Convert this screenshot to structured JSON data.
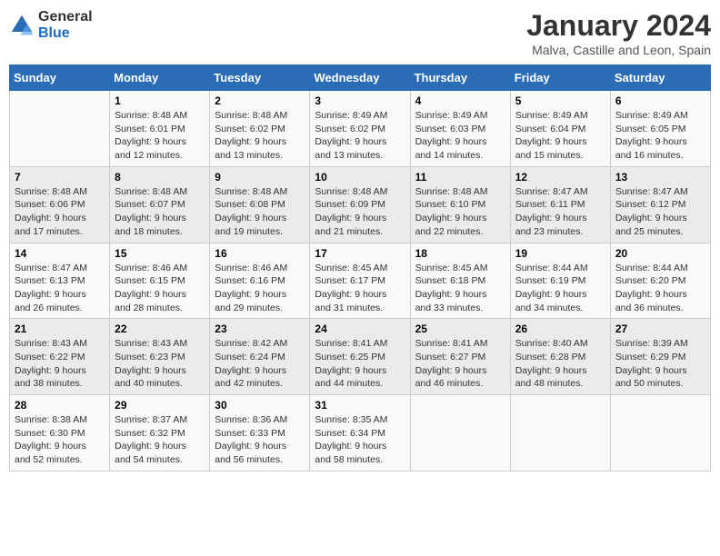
{
  "logo": {
    "general": "General",
    "blue": "Blue"
  },
  "header": {
    "month": "January 2024",
    "location": "Malva, Castille and Leon, Spain"
  },
  "columns": [
    "Sunday",
    "Monday",
    "Tuesday",
    "Wednesday",
    "Thursday",
    "Friday",
    "Saturday"
  ],
  "weeks": [
    [
      {
        "day": "",
        "content": ""
      },
      {
        "day": "1",
        "content": "Sunrise: 8:48 AM\nSunset: 6:01 PM\nDaylight: 9 hours\nand 12 minutes."
      },
      {
        "day": "2",
        "content": "Sunrise: 8:48 AM\nSunset: 6:02 PM\nDaylight: 9 hours\nand 13 minutes."
      },
      {
        "day": "3",
        "content": "Sunrise: 8:49 AM\nSunset: 6:02 PM\nDaylight: 9 hours\nand 13 minutes."
      },
      {
        "day": "4",
        "content": "Sunrise: 8:49 AM\nSunset: 6:03 PM\nDaylight: 9 hours\nand 14 minutes."
      },
      {
        "day": "5",
        "content": "Sunrise: 8:49 AM\nSunset: 6:04 PM\nDaylight: 9 hours\nand 15 minutes."
      },
      {
        "day": "6",
        "content": "Sunrise: 8:49 AM\nSunset: 6:05 PM\nDaylight: 9 hours\nand 16 minutes."
      }
    ],
    [
      {
        "day": "7",
        "content": "Sunrise: 8:48 AM\nSunset: 6:06 PM\nDaylight: 9 hours\nand 17 minutes."
      },
      {
        "day": "8",
        "content": "Sunrise: 8:48 AM\nSunset: 6:07 PM\nDaylight: 9 hours\nand 18 minutes."
      },
      {
        "day": "9",
        "content": "Sunrise: 8:48 AM\nSunset: 6:08 PM\nDaylight: 9 hours\nand 19 minutes."
      },
      {
        "day": "10",
        "content": "Sunrise: 8:48 AM\nSunset: 6:09 PM\nDaylight: 9 hours\nand 21 minutes."
      },
      {
        "day": "11",
        "content": "Sunrise: 8:48 AM\nSunset: 6:10 PM\nDaylight: 9 hours\nand 22 minutes."
      },
      {
        "day": "12",
        "content": "Sunrise: 8:47 AM\nSunset: 6:11 PM\nDaylight: 9 hours\nand 23 minutes."
      },
      {
        "day": "13",
        "content": "Sunrise: 8:47 AM\nSunset: 6:12 PM\nDaylight: 9 hours\nand 25 minutes."
      }
    ],
    [
      {
        "day": "14",
        "content": "Sunrise: 8:47 AM\nSunset: 6:13 PM\nDaylight: 9 hours\nand 26 minutes."
      },
      {
        "day": "15",
        "content": "Sunrise: 8:46 AM\nSunset: 6:15 PM\nDaylight: 9 hours\nand 28 minutes."
      },
      {
        "day": "16",
        "content": "Sunrise: 8:46 AM\nSunset: 6:16 PM\nDaylight: 9 hours\nand 29 minutes."
      },
      {
        "day": "17",
        "content": "Sunrise: 8:45 AM\nSunset: 6:17 PM\nDaylight: 9 hours\nand 31 minutes."
      },
      {
        "day": "18",
        "content": "Sunrise: 8:45 AM\nSunset: 6:18 PM\nDaylight: 9 hours\nand 33 minutes."
      },
      {
        "day": "19",
        "content": "Sunrise: 8:44 AM\nSunset: 6:19 PM\nDaylight: 9 hours\nand 34 minutes."
      },
      {
        "day": "20",
        "content": "Sunrise: 8:44 AM\nSunset: 6:20 PM\nDaylight: 9 hours\nand 36 minutes."
      }
    ],
    [
      {
        "day": "21",
        "content": "Sunrise: 8:43 AM\nSunset: 6:22 PM\nDaylight: 9 hours\nand 38 minutes."
      },
      {
        "day": "22",
        "content": "Sunrise: 8:43 AM\nSunset: 6:23 PM\nDaylight: 9 hours\nand 40 minutes."
      },
      {
        "day": "23",
        "content": "Sunrise: 8:42 AM\nSunset: 6:24 PM\nDaylight: 9 hours\nand 42 minutes."
      },
      {
        "day": "24",
        "content": "Sunrise: 8:41 AM\nSunset: 6:25 PM\nDaylight: 9 hours\nand 44 minutes."
      },
      {
        "day": "25",
        "content": "Sunrise: 8:41 AM\nSunset: 6:27 PM\nDaylight: 9 hours\nand 46 minutes."
      },
      {
        "day": "26",
        "content": "Sunrise: 8:40 AM\nSunset: 6:28 PM\nDaylight: 9 hours\nand 48 minutes."
      },
      {
        "day": "27",
        "content": "Sunrise: 8:39 AM\nSunset: 6:29 PM\nDaylight: 9 hours\nand 50 minutes."
      }
    ],
    [
      {
        "day": "28",
        "content": "Sunrise: 8:38 AM\nSunset: 6:30 PM\nDaylight: 9 hours\nand 52 minutes."
      },
      {
        "day": "29",
        "content": "Sunrise: 8:37 AM\nSunset: 6:32 PM\nDaylight: 9 hours\nand 54 minutes."
      },
      {
        "day": "30",
        "content": "Sunrise: 8:36 AM\nSunset: 6:33 PM\nDaylight: 9 hours\nand 56 minutes."
      },
      {
        "day": "31",
        "content": "Sunrise: 8:35 AM\nSunset: 6:34 PM\nDaylight: 9 hours\nand 58 minutes."
      },
      {
        "day": "",
        "content": ""
      },
      {
        "day": "",
        "content": ""
      },
      {
        "day": "",
        "content": ""
      }
    ]
  ]
}
